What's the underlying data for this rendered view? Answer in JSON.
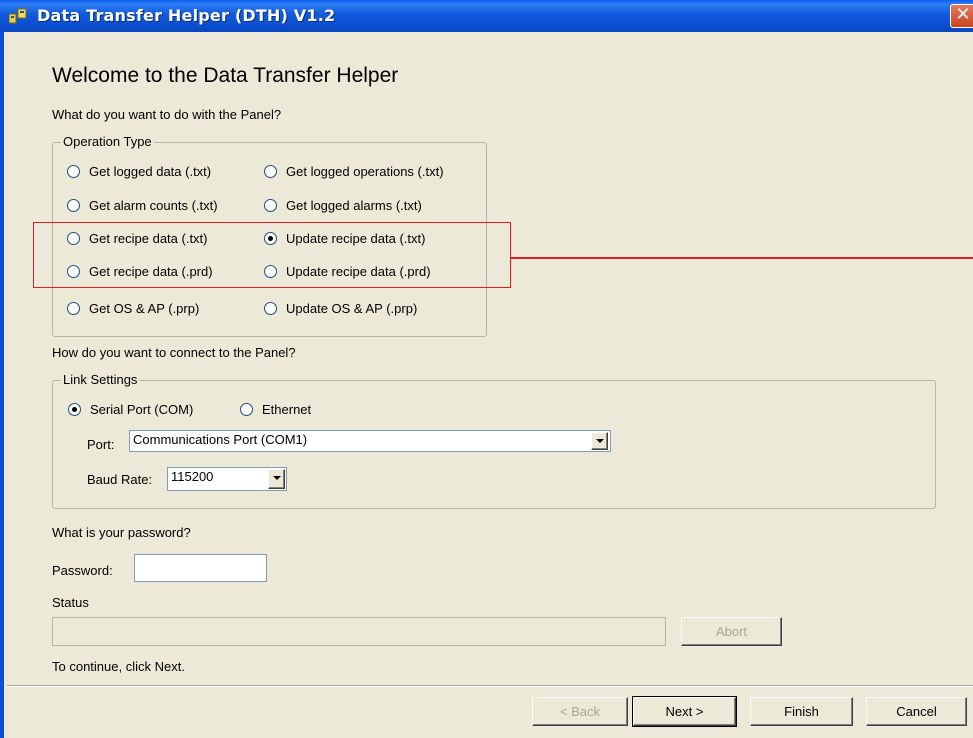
{
  "window": {
    "title": "Data Transfer Helper (DTH) V1.2",
    "close_glyph": "✕"
  },
  "heading": "Welcome to the Data Transfer Helper",
  "operation_section": {
    "question": "What do you want to do with the Panel?",
    "group_label": "Operation Type",
    "options": [
      {
        "label": "Get logged data (.txt)",
        "checked": false
      },
      {
        "label": "Get logged operations (.txt)",
        "checked": false
      },
      {
        "label": "Get alarm counts (.txt)",
        "checked": false
      },
      {
        "label": "Get logged alarms (.txt)",
        "checked": false
      },
      {
        "label": "Get recipe data (.txt)",
        "checked": false
      },
      {
        "label": "Update recipe data (.txt)",
        "checked": true
      },
      {
        "label": "Get recipe data (.prd)",
        "checked": false
      },
      {
        "label": "Update recipe data (.prd)",
        "checked": false
      },
      {
        "label": "Get OS & AP (.prp)",
        "checked": false
      },
      {
        "label": "Update OS & AP (.prp)",
        "checked": false
      }
    ]
  },
  "connection_section": {
    "question": "How do you want to connect to the Panel?",
    "group_label": "Link Settings",
    "modes": [
      {
        "label": "Serial Port (COM)",
        "checked": true
      },
      {
        "label": "Ethernet",
        "checked": false
      }
    ],
    "port_label": "Port:",
    "port_value": "Communications Port (COM1)",
    "baud_label": "Baud Rate:",
    "baud_value": "115200"
  },
  "password_section": {
    "question": "What is your password?",
    "label": "Password:",
    "value": ""
  },
  "status_section": {
    "label": "Status",
    "progress": 0,
    "abort_label": "Abort"
  },
  "instruction": "To continue, click Next.",
  "buttons": {
    "back": "< Back",
    "next": "Next >",
    "finish": "Finish",
    "cancel": "Cancel"
  },
  "colors": {
    "titlebar": "#0b54d8",
    "dialog_bg": "#ece9d8",
    "highlight": "#e51c1c"
  }
}
